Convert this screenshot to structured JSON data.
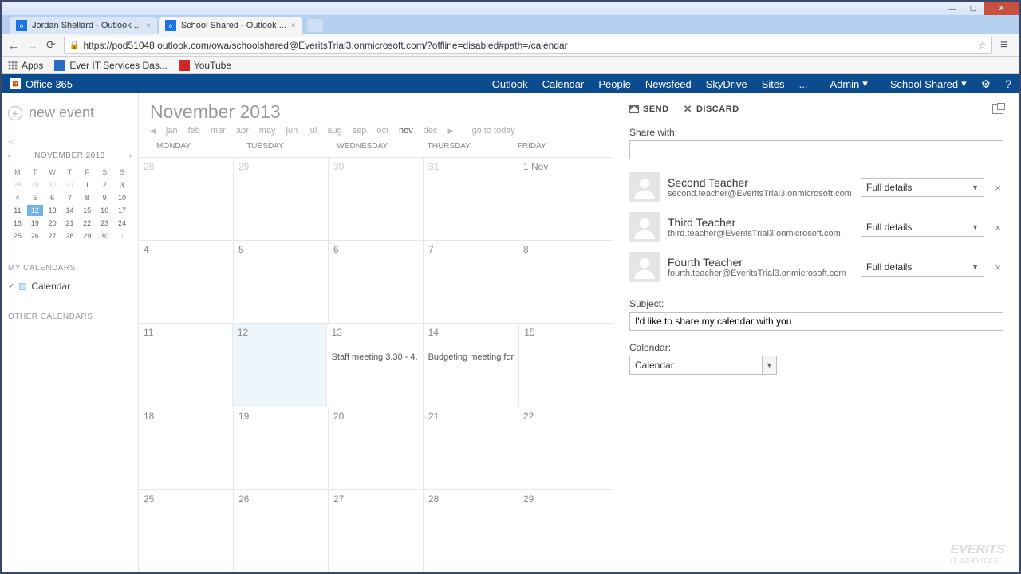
{
  "browser": {
    "tabs": [
      {
        "title": "Jordan Shellard - Outlook ...",
        "active": false
      },
      {
        "title": "School Shared - Outlook ...",
        "active": true
      }
    ],
    "url": "https://pod51048.outlook.com/owa/schoolshared@EveritsTrial3.onmicrosoft.com/?offline=disabled#path=/calendar",
    "bookmarks": {
      "apps": "Apps",
      "ever": "Ever IT Services Das...",
      "youtube": "YouTube"
    }
  },
  "o365": {
    "brand": "Office 365",
    "nav": {
      "outlook": "Outlook",
      "calendar": "Calendar",
      "people": "People",
      "newsfeed": "Newsfeed",
      "skydrive": "SkyDrive",
      "sites": "Sites",
      "more": "...",
      "admin": "Admin"
    },
    "account": "School Shared"
  },
  "sidebar": {
    "new_event": "new event",
    "mini_title": "NOVEMBER 2013",
    "dow": [
      "M",
      "T",
      "W",
      "T",
      "F",
      "S",
      "S"
    ],
    "weeks": [
      [
        {
          "d": "28",
          "o": true
        },
        {
          "d": "29",
          "o": true
        },
        {
          "d": "30",
          "o": true
        },
        {
          "d": "31",
          "o": true
        },
        {
          "d": "1"
        },
        {
          "d": "2"
        },
        {
          "d": "3"
        }
      ],
      [
        {
          "d": "4"
        },
        {
          "d": "5"
        },
        {
          "d": "6"
        },
        {
          "d": "7"
        },
        {
          "d": "8"
        },
        {
          "d": "9"
        },
        {
          "d": "10"
        }
      ],
      [
        {
          "d": "11"
        },
        {
          "d": "12",
          "sel": true
        },
        {
          "d": "13"
        },
        {
          "d": "14"
        },
        {
          "d": "15"
        },
        {
          "d": "16"
        },
        {
          "d": "17"
        }
      ],
      [
        {
          "d": "18"
        },
        {
          "d": "19"
        },
        {
          "d": "20"
        },
        {
          "d": "21"
        },
        {
          "d": "22"
        },
        {
          "d": "23"
        },
        {
          "d": "24"
        }
      ],
      [
        {
          "d": "25"
        },
        {
          "d": "26"
        },
        {
          "d": "27"
        },
        {
          "d": "28"
        },
        {
          "d": "29"
        },
        {
          "d": "30"
        },
        {
          "d": "1",
          "o": true
        }
      ]
    ],
    "my_calendars": "MY CALENDARS",
    "calendar_item": "Calendar",
    "other_calendars": "OTHER CALENDARS"
  },
  "calendar": {
    "title": "November 2013",
    "months": {
      "jan": "jan",
      "feb": "feb",
      "mar": "mar",
      "apr": "apr",
      "may": "may",
      "jun": "jun",
      "jul": "jul",
      "aug": "aug",
      "sep": "sep",
      "oct": "oct",
      "nov": "nov",
      "dec": "dec"
    },
    "go_today": "go to today",
    "dow": {
      "mon": "MONDAY",
      "tue": "TUESDAY",
      "wed": "WEDNESDAY",
      "thu": "THURSDAY",
      "fri": "FRIDAY"
    },
    "weeks": [
      [
        {
          "d": "28",
          "o": true
        },
        {
          "d": "29",
          "o": true
        },
        {
          "d": "30",
          "o": true
        },
        {
          "d": "31",
          "o": true
        },
        {
          "d": "1 Nov"
        }
      ],
      [
        {
          "d": "4"
        },
        {
          "d": "5"
        },
        {
          "d": "6"
        },
        {
          "d": "7"
        },
        {
          "d": "8"
        }
      ],
      [
        {
          "d": "11"
        },
        {
          "d": "12",
          "today": true
        },
        {
          "d": "13",
          "ev": "Staff meeting 3.30 - 4."
        },
        {
          "d": "14",
          "ev": "Budgeting meeting for"
        },
        {
          "d": "15"
        }
      ],
      [
        {
          "d": "18"
        },
        {
          "d": "19"
        },
        {
          "d": "20"
        },
        {
          "d": "21"
        },
        {
          "d": "22"
        }
      ],
      [
        {
          "d": "25"
        },
        {
          "d": "26"
        },
        {
          "d": "27"
        },
        {
          "d": "28"
        },
        {
          "d": "29"
        }
      ]
    ]
  },
  "panel": {
    "send": "SEND",
    "discard": "DISCARD",
    "share_with_label": "Share with:",
    "share_with_value": "",
    "recipients": [
      {
        "name": "Second Teacher",
        "email": "second.teacher@EveritsTrial3.onmicrosoft.com",
        "perm": "Full details"
      },
      {
        "name": "Third Teacher",
        "email": "third.teacher@EveritsTrial3.onmicrosoft.com",
        "perm": "Full details"
      },
      {
        "name": "Fourth Teacher",
        "email": "fourth.teacher@EveritsTrial3.onmicrosoft.com",
        "perm": "Full details"
      }
    ],
    "subject_label": "Subject:",
    "subject_value": "I'd like to share my calendar with you",
    "calendar_label": "Calendar:",
    "calendar_value": "Calendar"
  },
  "watermark": {
    "brand": "EVERITS",
    "sub": "IT SERVICES"
  }
}
